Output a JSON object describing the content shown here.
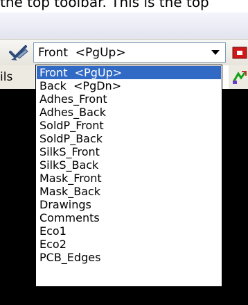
{
  "caption": {
    "text": "the top toolbar. This is the top"
  },
  "toolbar": {
    "layer_select": {
      "value": "Front  <PgUp>"
    }
  },
  "left_panel": {
    "label_fragment": "ils"
  },
  "layer_dropdown": {
    "selected": "Front  <PgUp>",
    "items": [
      "Front  <PgUp>",
      "Back  <PgDn>",
      "Adhes_Front",
      "Adhes_Back",
      "SoldP_Front",
      "SoldP_Back",
      "SilkS_Front",
      "SilkS_Back",
      "Mask_Front",
      "Mask_Back",
      "Drawings",
      "Comments",
      "Eco1",
      "Eco2",
      "PCB_Edges"
    ]
  },
  "icons": {
    "tool": "checkmark-pen-icon",
    "red": "red-layer-icon",
    "green": "green-arrows-icon",
    "dropdown_arrow": "chevron-down-icon"
  },
  "colors": {
    "selection": "#316ac5",
    "canvas": "#000000"
  }
}
